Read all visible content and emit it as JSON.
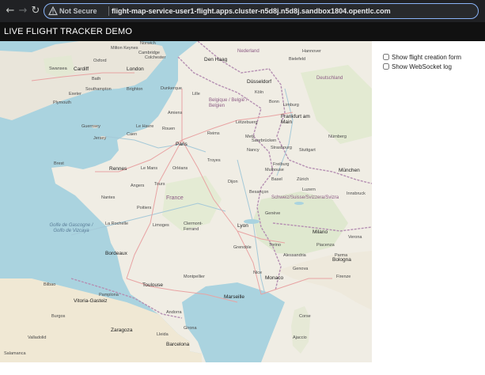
{
  "browser": {
    "security_label": "Not Secure",
    "url": "flight-map-service-user1-flight.apps.cluster-n5d8j.n5d8j.sandbox1804.opentlc.com",
    "icons": {
      "back": "back-arrow-icon",
      "forward": "forward-arrow-icon",
      "reload": "reload-icon",
      "warning": "warning-triangle-icon"
    }
  },
  "header": {
    "title": "LIVE FLIGHT TRACKER DEMO"
  },
  "options": [
    {
      "label": "Show flight creation form",
      "checked": false
    },
    {
      "label": "Show WebSocket log",
      "checked": false
    }
  ],
  "map": {
    "labels": {
      "norwich": "Norwich",
      "milton": "Milton Keynes",
      "cambridge": "Cambridge",
      "colchester": "Colchester",
      "oxford": "Oxford",
      "cardiff": "Cardiff",
      "london": "London",
      "swansea": "Swansea",
      "bath": "Bath",
      "southampton": "Southampton",
      "brighton": "Brighton",
      "exeter": "Exeter",
      "plymouth": "Plymouth",
      "dunkerque": "Dunkerque",
      "lille": "Lille",
      "denhaag": "Den Haag",
      "nederland": "Nederland",
      "hannover": "Hannover",
      "bielefeld": "Bielefeld",
      "dusseldorf": "Düsseldorf",
      "koln": "Köln",
      "bonn": "Bonn",
      "belgique": "Belgique / België / Belgien",
      "deutschland": "Deutschland",
      "frankfurt": "Frankfurt am Main",
      "luxembourg": "Lëtzebuerg",
      "nurnberg": "Nürnberg",
      "saarbrucken": "Saarbrücken",
      "stuttgart": "Stuttgart",
      "munchen": "München",
      "freiburg": "Freiburg",
      "guernsey": "Guernsey",
      "jersey": "Jersey",
      "lehavre": "Le Havre",
      "rouen": "Rouen",
      "caen": "Caen",
      "paris": "Paris",
      "reims": "Reims",
      "brest": "Brest",
      "rennes": "Rennes",
      "lemans": "Le Mans",
      "orleans": "Orléans",
      "troyes": "Troyes",
      "nancy": "Nancy",
      "strasbourg": "Strasbourg",
      "nantes": "Nantes",
      "angers": "Angers",
      "tours": "Tours",
      "france": "France",
      "dijon": "Dijon",
      "besancon": "Besançon",
      "basel": "Basel",
      "zurich": "Zürich",
      "schweiz": "Schweiz/Suisse/Svizzera/Svizra",
      "poitiers": "Poitiers",
      "larochelle": "La Rochelle",
      "limoges": "Limoges",
      "lyon": "Lyon",
      "clermont": "Clermont-Ferrand",
      "geneve": "Genève",
      "grenoble": "Grenoble",
      "golfe": "Golfe de Gascogne / Golfo de Vizcaya",
      "bordeaux": "Bordeaux",
      "toulouse": "Toulouse",
      "montpellier": "Montpellier",
      "marseille": "Marseille",
      "nice": "Nice",
      "monaco": "Monaco",
      "torino": "Torino",
      "milano": "Milano",
      "genova": "Genova",
      "parma": "Parma",
      "bologna": "Bologna",
      "firenze": "Firenze",
      "bilbao": "Bilbao",
      "vitoria": "Vitoria-Gasteiz",
      "pamplona": "Pamplona",
      "andorra": "Andorra",
      "zaragoza": "Zaragoza",
      "girona": "Girona",
      "barcelona": "Barcelona",
      "lleida": "Lleida",
      "corse": "Corse",
      "ajaccio": "Ajaccio",
      "salamanca": "Salamanca",
      "valladolid": "Valladolid",
      "burgos": "Burgos",
      "mulhouse": "Mulhouse",
      "metz": "Metz",
      "amiens": "Amiens",
      "limburg": "Limburg",
      "luzern": "Luzern",
      "innsbruck": "Innsbruck",
      "verona": "Verona",
      "alessandria": "Alessandria",
      "piacenza": "Piacenza"
    }
  }
}
